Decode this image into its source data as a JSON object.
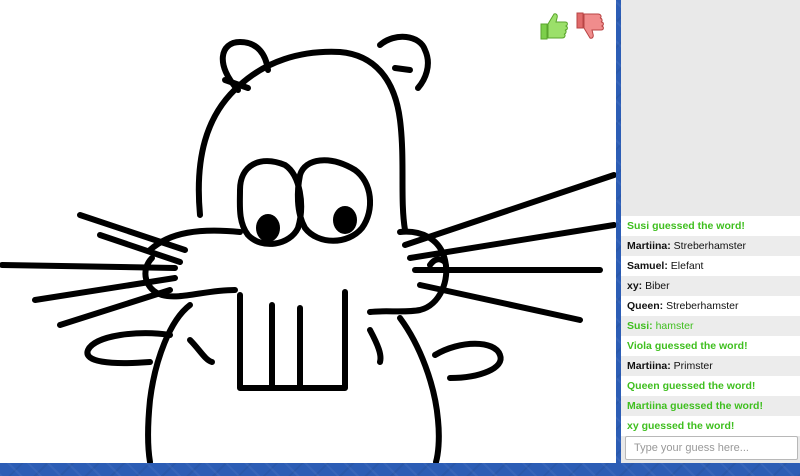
{
  "vote": {
    "like_icon": "thumbs-up-icon",
    "dislike_icon": "thumbs-down-icon",
    "like_color": "#7ccf4a",
    "dislike_color": "#e06a6a"
  },
  "chat": {
    "messages": [
      {
        "type": "system",
        "text": "Susi guessed the word!"
      },
      {
        "type": "message",
        "name": "Martiina:",
        "text": " Streberhamster"
      },
      {
        "type": "message",
        "name": "Samuel:",
        "text": " Elefant"
      },
      {
        "type": "message",
        "name": "xy:",
        "text": " Biber"
      },
      {
        "type": "message",
        "name": "Queen:",
        "text": " Streberhamster"
      },
      {
        "type": "correct",
        "name": "Susi:",
        "text": " hamster"
      },
      {
        "type": "system",
        "text": "Viola guessed the word!"
      },
      {
        "type": "message",
        "name": "Martiina:",
        "text": " Primster"
      },
      {
        "type": "system",
        "text": "Queen guessed the word!"
      },
      {
        "type": "system",
        "text": "Martiina guessed the word!"
      },
      {
        "type": "system",
        "text": "xy guessed the word!"
      }
    ]
  },
  "guess_input": {
    "placeholder": "Type your guess here..."
  },
  "colors": {
    "system_message": "#3fbf1f",
    "page_background": "#2c5db5"
  }
}
